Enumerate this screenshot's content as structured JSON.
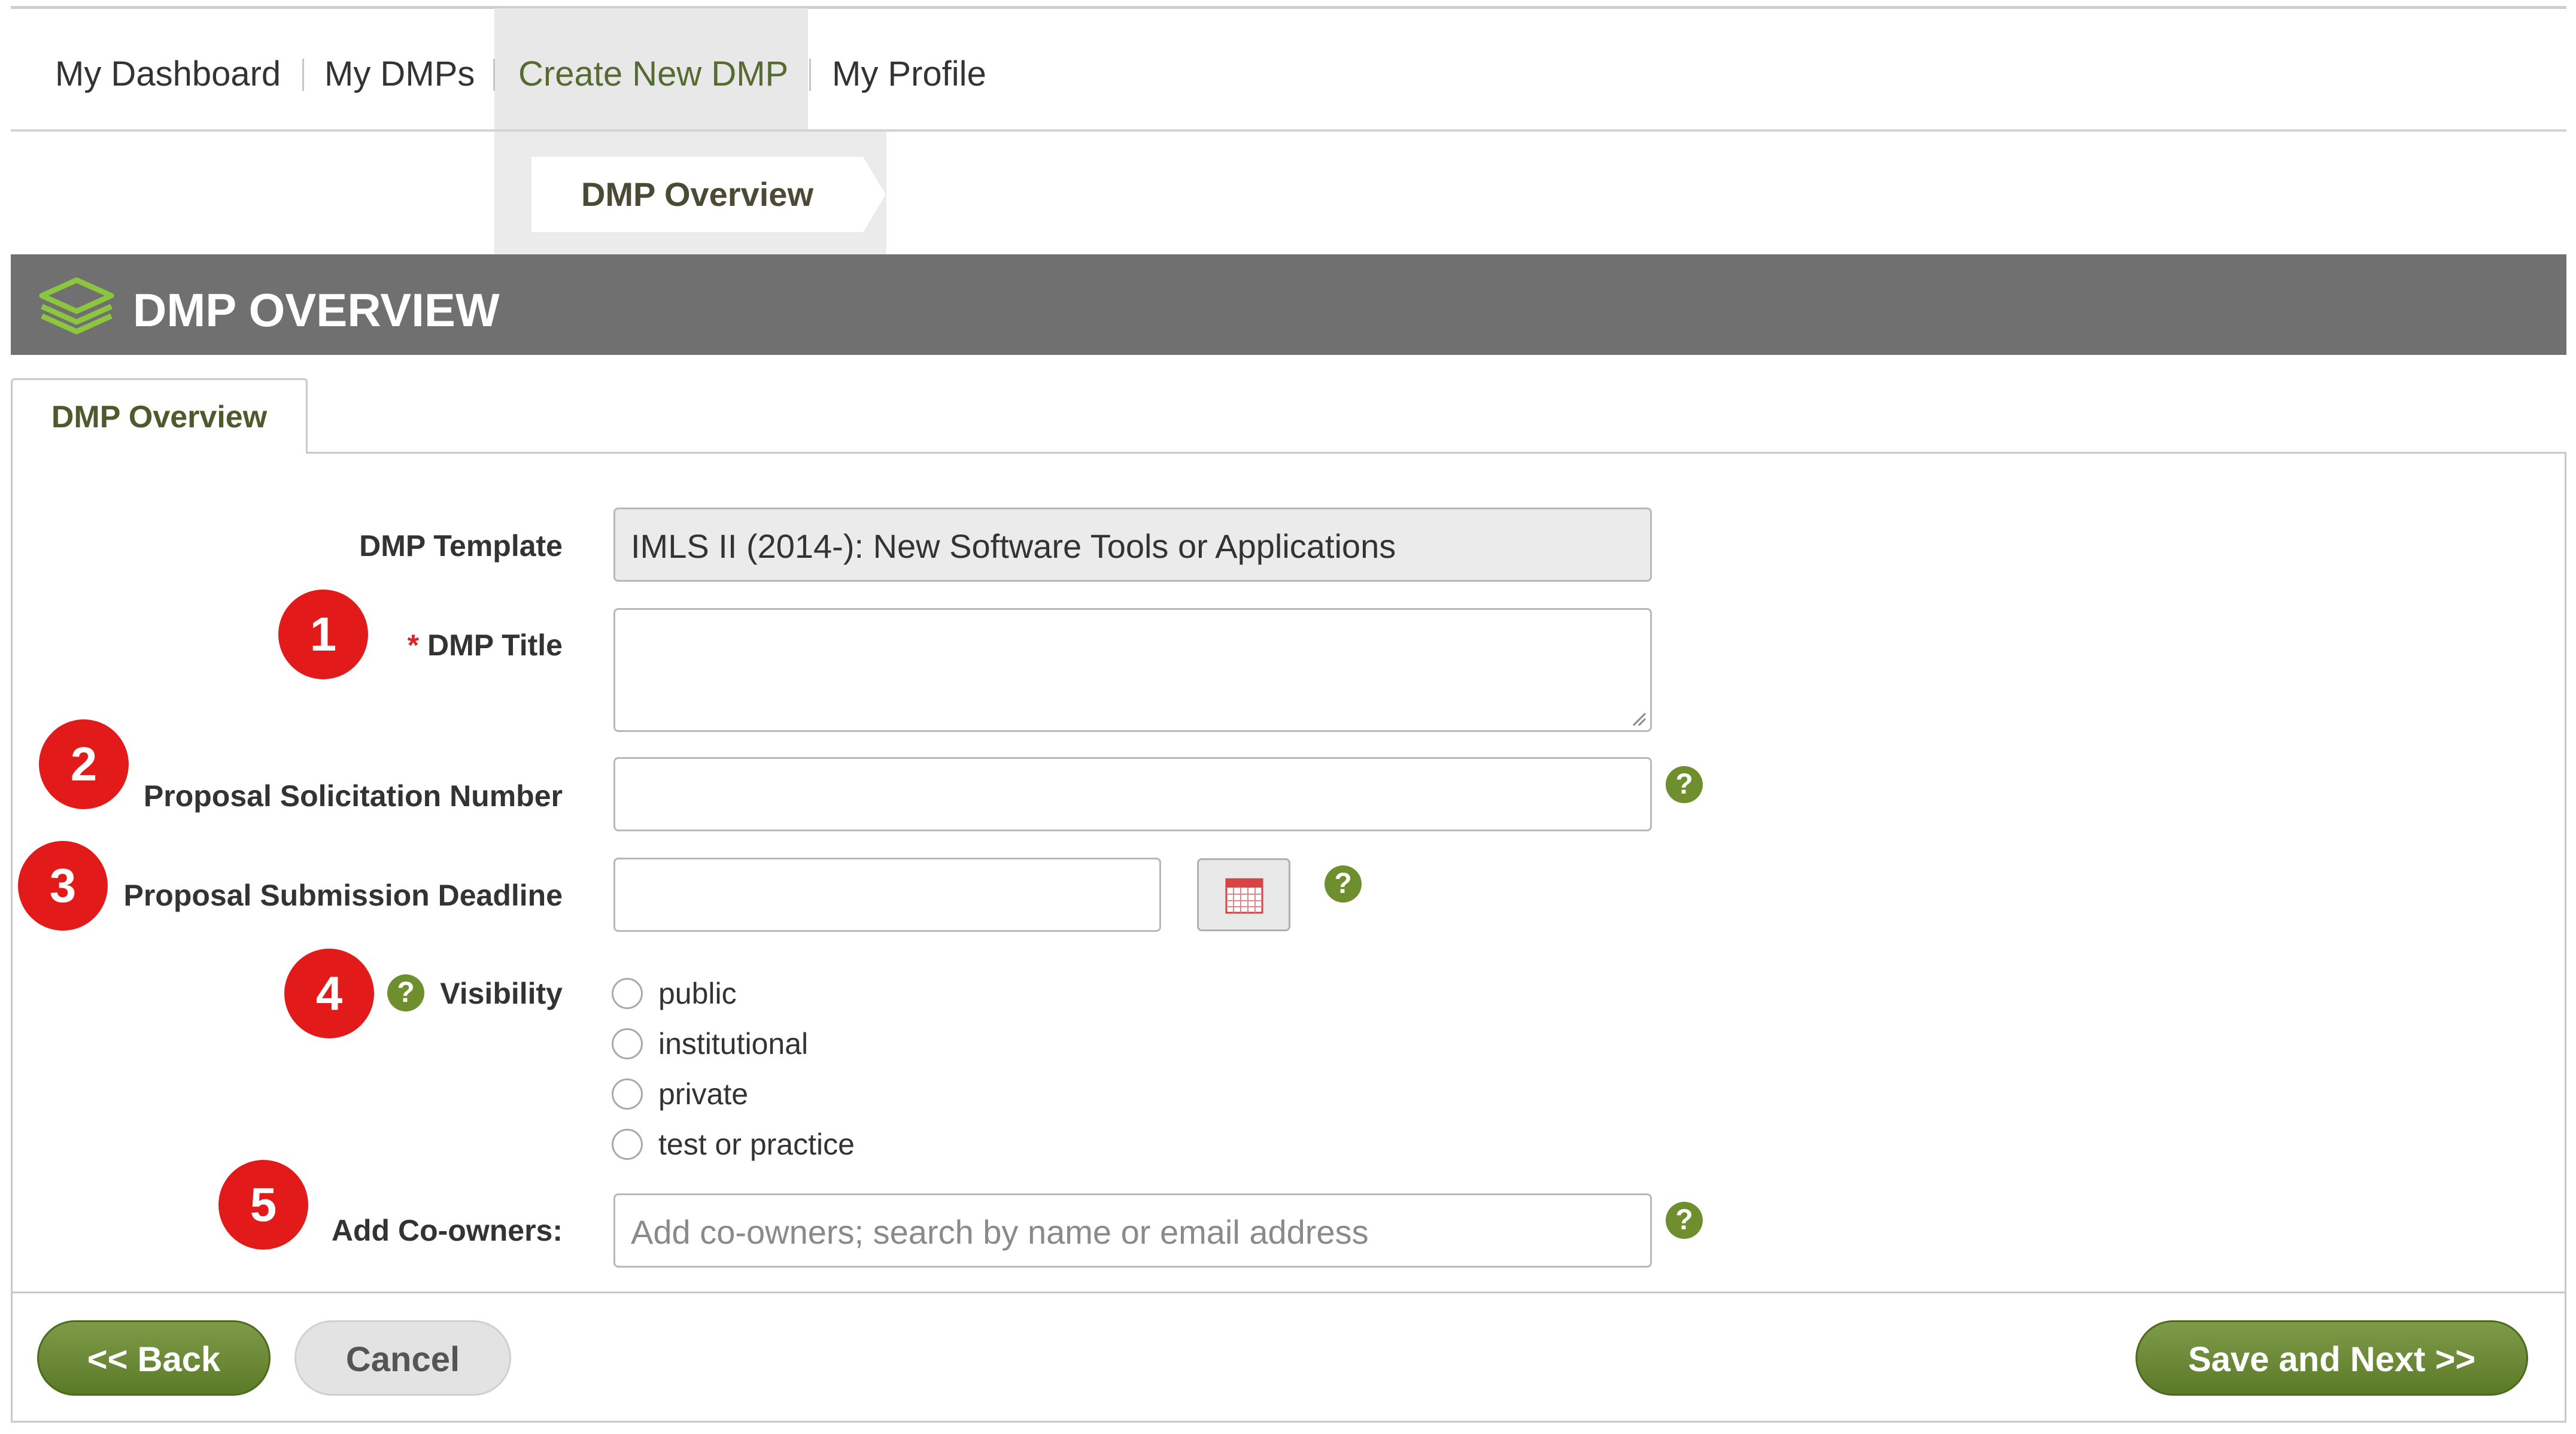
{
  "nav": {
    "items": [
      {
        "label": "My Dashboard"
      },
      {
        "label": "My DMPs"
      },
      {
        "label": "Create New DMP"
      },
      {
        "label": "My Profile"
      }
    ]
  },
  "step": {
    "label": "DMP Overview"
  },
  "section": {
    "title": "DMP OVERVIEW"
  },
  "tab": {
    "label": "DMP Overview"
  },
  "form": {
    "template_label": "DMP Template",
    "template_value": "IMLS II (2014-): New Software Tools or Applications",
    "title_required": "*",
    "title_label": "DMP Title",
    "title_value": "",
    "solicitation_label": "Proposal Solicitation Number",
    "solicitation_value": "",
    "deadline_label": "Proposal Submission Deadline",
    "deadline_value": "",
    "visibility_label": "Visibility",
    "visibility_options": [
      "public",
      "institutional",
      "private",
      "test or practice"
    ],
    "coowners_label": "Add Co-owners:",
    "coowners_placeholder": "Add co-owners; search by name or email address",
    "help_glyph": "?"
  },
  "markers": [
    "1",
    "2",
    "3",
    "4",
    "5"
  ],
  "buttons": {
    "back": "<< Back",
    "cancel": "Cancel",
    "save_next": "Save and Next >>"
  },
  "colors": {
    "accent_green": "#6f8e2e",
    "header_grey": "#707070",
    "marker_red": "#e21a1a"
  }
}
